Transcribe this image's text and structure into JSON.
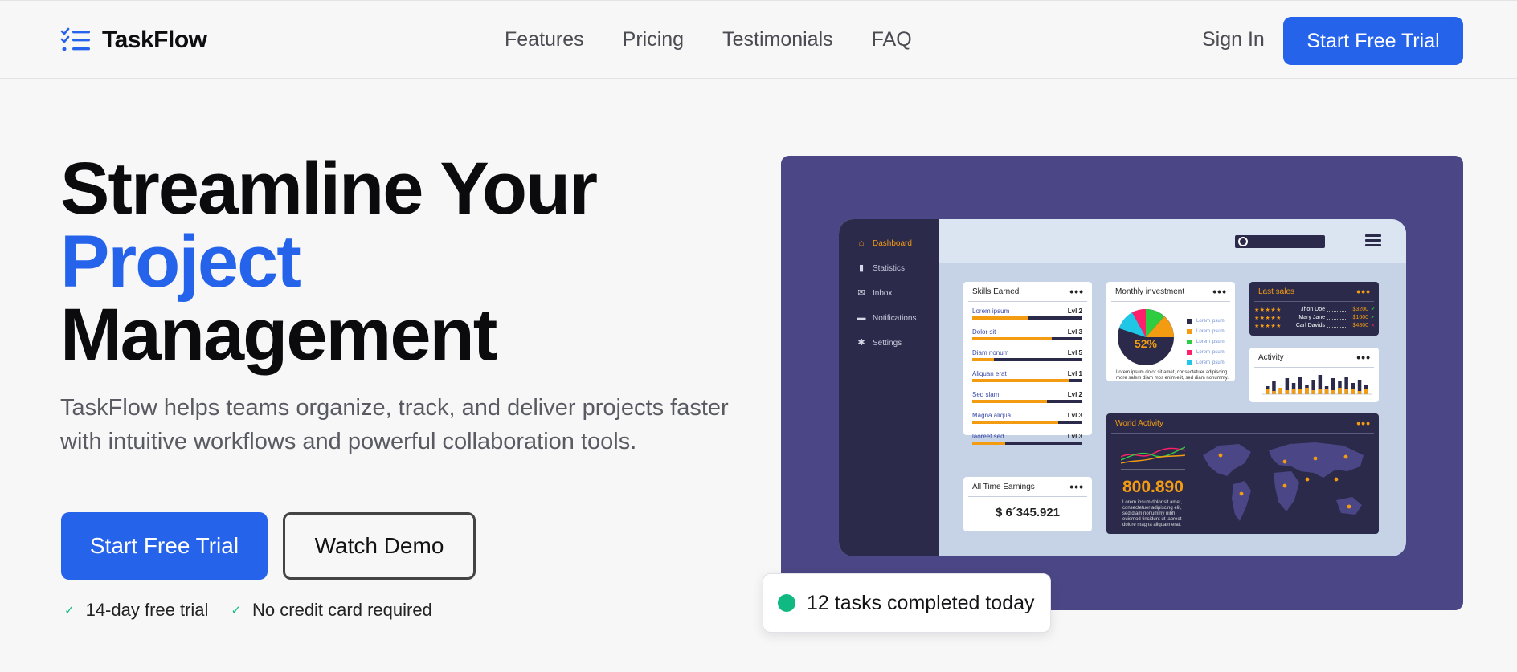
{
  "brand": {
    "name": "TaskFlow",
    "accent": "#2563eb"
  },
  "nav": {
    "items": [
      "Features",
      "Pricing",
      "Testimonials",
      "FAQ"
    ],
    "signin": "Sign In",
    "cta": "Start Free Trial"
  },
  "hero": {
    "title_line1": "Streamline Your",
    "title_line2": "Project",
    "title_line3": "Management",
    "subtitle": "TaskFlow helps teams organize, track, and deliver projects faster with intuitive workflows and powerful collaboration tools.",
    "primary_button": "Start Free Trial",
    "secondary_button": "Watch Demo",
    "perks": [
      "14-day free trial",
      "No credit card required"
    ]
  },
  "dashboard": {
    "sidebar": [
      "Dashboard",
      "Statistics",
      "Inbox",
      "Notifications",
      "Settings"
    ],
    "skills": {
      "title": "Skills Earned",
      "rows": [
        {
          "label": "Lorem ipsum",
          "level": "Lvl 2",
          "pct": 0.5
        },
        {
          "label": "Dolor sit",
          "level": "Lvl 3",
          "pct": 0.72
        },
        {
          "label": "Diam nonum",
          "level": "Lvl 5",
          "pct": 0.2
        },
        {
          "label": "Aliquan erat",
          "level": "Lvl 1",
          "pct": 0.88
        },
        {
          "label": "Sed slam",
          "level": "Lvl 2",
          "pct": 0.68
        },
        {
          "label": "Magna aliqua",
          "level": "Lvl 3",
          "pct": 0.78
        },
        {
          "label": "laoreet sed",
          "level": "Lvl 3",
          "pct": 0.3
        }
      ]
    },
    "earnings": {
      "title": "All Time Earnings",
      "value": "$ 6´345.921"
    },
    "investment": {
      "title": "Monthly investment",
      "center_label": "52%",
      "legend": [
        "Lorem ipsum",
        "Lorem ipsum",
        "Lorem ipsum",
        "Lorem ipsum",
        "Lorem ipsum"
      ],
      "legend_colors": [
        "#2b2a4a",
        "#f39c12",
        "#2ecc40",
        "#ff1f6b",
        "#1fc6e6"
      ],
      "caption": "Lorem ipsum dolor sit amet, consectetuer adipiscing more salem diam mos enim elit, sed diam nonummy."
    },
    "sales": {
      "title": "Last sales",
      "rows": [
        {
          "name": "Jhon Doe",
          "amount": "$3200",
          "mark": "✔"
        },
        {
          "name": "Mary Jane",
          "amount": "$1600",
          "mark": "✔"
        },
        {
          "name": "Carl Davids",
          "amount": "$4800",
          "mark": "✕"
        }
      ]
    },
    "activity": {
      "title": "Activity"
    },
    "world": {
      "title": "World Activity",
      "value": "800.890",
      "caption": "Lorem ipsum dolor sit amet, consectetuer adipiscing elit, sed diam nonummy nibh euismod tincidunt ut laoreet dolore magna aliquam erat."
    }
  },
  "toast": {
    "text": "12 tasks completed today",
    "status_color": "#10b981"
  }
}
